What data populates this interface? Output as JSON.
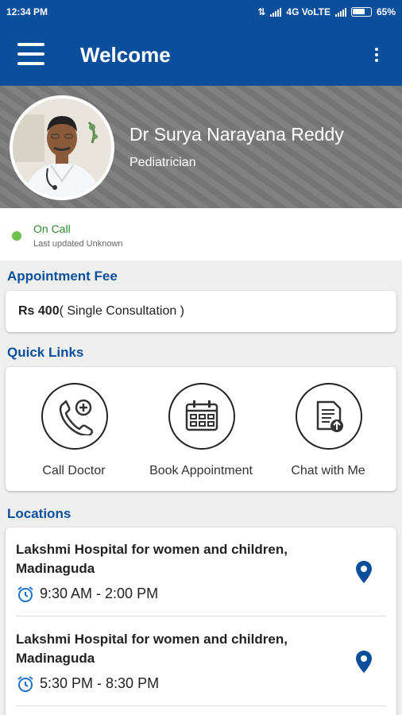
{
  "status_bar": {
    "time": "12:34 PM",
    "network": "4G VoLTE",
    "battery": "65%"
  },
  "app_bar": {
    "title": "Welcome"
  },
  "profile": {
    "name": "Dr Surya Narayana Reddy",
    "specialty": "Pediatrician"
  },
  "availability": {
    "status": "On Call",
    "last_updated": "Last updated Unknown",
    "status_color": "#6cc24a"
  },
  "appointment_fee": {
    "heading": "Appointment Fee",
    "amount": "Rs 400",
    "note": "( Single Consultation )"
  },
  "quick_links": {
    "heading": "Quick Links",
    "items": [
      {
        "label": "Call Doctor",
        "icon": "phone-plus-icon"
      },
      {
        "label": "Book Appointment",
        "icon": "calendar-icon"
      },
      {
        "label": "Chat with Me",
        "icon": "document-upload-icon"
      }
    ]
  },
  "locations": {
    "heading": "Locations",
    "items": [
      {
        "name": "Lakshmi Hospital for women and children, Madinaguda",
        "time": "9:30 AM - 2:00 PM"
      },
      {
        "name": "Lakshmi Hospital for women and children, Madinaguda",
        "time": "5:30 PM - 8:30 PM"
      }
    ]
  },
  "colors": {
    "primary": "#0a4f9c",
    "online": "#6cc24a"
  }
}
